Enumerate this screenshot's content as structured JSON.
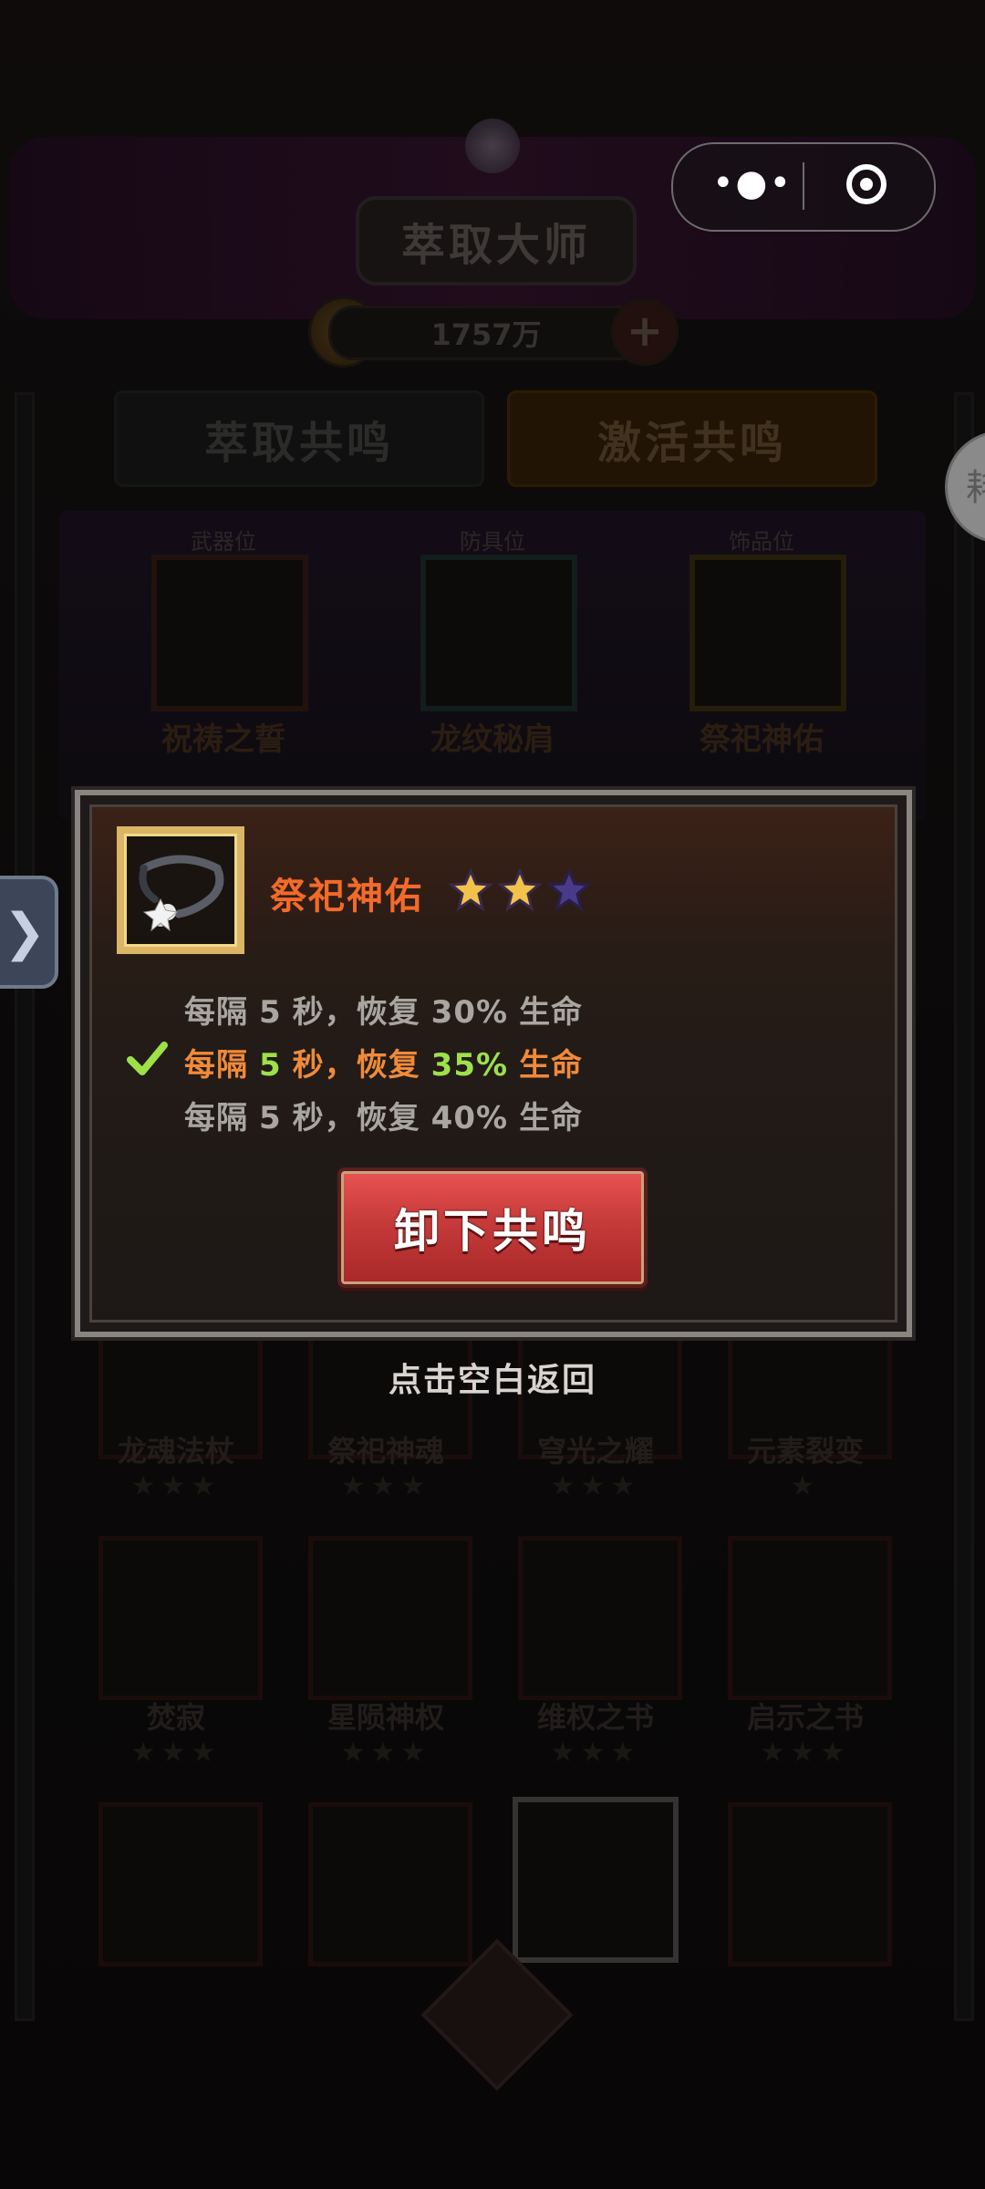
{
  "header": {
    "title": "萃取大师",
    "currency": "1757万"
  },
  "tabs": [
    {
      "label": "萃取共鸣",
      "active": false
    },
    {
      "label": "激活共鸣",
      "active": true
    }
  ],
  "slots": [
    {
      "position_label": "武器位",
      "name": "祝祷之誓"
    },
    {
      "position_label": "防具位",
      "name": "龙纹秘肩"
    },
    {
      "position_label": "饰品位",
      "name": "祭祀神佑"
    }
  ],
  "grid_items": [
    {
      "name": "龙魂法杖",
      "stars": "★★★"
    },
    {
      "name": "祭祀神魂",
      "stars": "★★★"
    },
    {
      "name": "穹光之耀",
      "stars": "★★★"
    },
    {
      "name": "元素裂变",
      "stars": "★"
    },
    {
      "name": "焚寂",
      "stars": "★★★"
    },
    {
      "name": "星陨神权",
      "stars": "★★★"
    },
    {
      "name": "维权之书",
      "stars": "★★★"
    },
    {
      "name": "启示之书",
      "stars": "★★★"
    }
  ],
  "popup": {
    "item_name": "祭祀神佑",
    "stars_filled": 2,
    "stars_total": 3,
    "effects": [
      {
        "prefix": "每隔",
        "seconds": "5",
        "unit": "秒，",
        "verb": "恢复",
        "percent": "30%",
        "suffix": "生命",
        "active": false
      },
      {
        "prefix": "每隔",
        "seconds": "5",
        "unit": "秒，",
        "verb": "恢复",
        "percent": "35%",
        "suffix": "生命",
        "active": true
      },
      {
        "prefix": "每隔",
        "seconds": "5",
        "unit": "秒，",
        "verb": "恢复",
        "percent": "40%",
        "suffix": "生命",
        "active": false
      }
    ],
    "button_label": "卸下共鸣"
  },
  "hint": "点击空白返回",
  "side_tab_right_text": "耗",
  "side_tab_left_glyph": "❯",
  "colors": {
    "title_orange": "#f26a2a",
    "active_effect_orange": "#f08a3a",
    "active_number_green": "#9ee04a",
    "inactive_effect": "#a9a6a2",
    "check_green": "#9ee04a",
    "button_red": "#c63a3a",
    "icon_frame_gold": "#d9b565"
  }
}
